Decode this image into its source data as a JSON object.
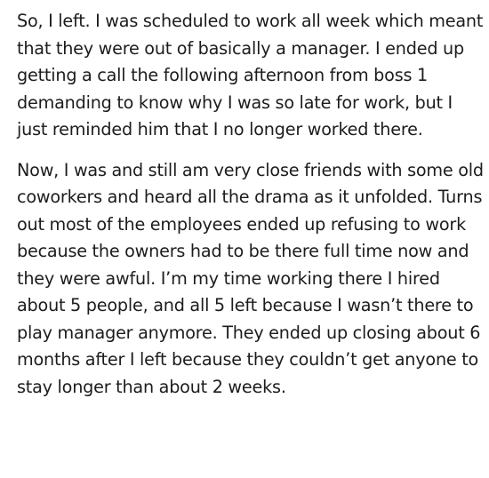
{
  "post": {
    "paragraphs": [
      "So, I left. I was scheduled to work all week which meant that they were out of basically a manager. I ended up getting a call the following afternoon from boss 1 demanding to know why I was so late for work, but I just reminded him that I no longer worked there.",
      "Now, I was and still am very close friends with some old coworkers and heard all the drama as it unfolded. Turns out most of the employees ended up refusing to work because the owners had to be there full time now and they were awful. I’m my time working there I hired about 5 people, and all 5 left because I wasn’t there to play manager anymore. They ended up closing about 6 months after I left because they couldn’t get anyone to stay longer than about 2 weeks."
    ]
  },
  "colors": {
    "text": "#1c1c1c",
    "background": "#ffffff"
  }
}
